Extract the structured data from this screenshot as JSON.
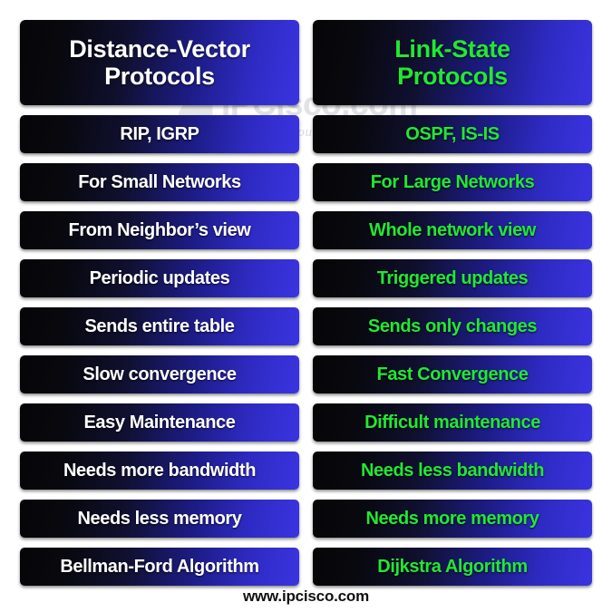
{
  "page": {
    "background_color": "#ffffff",
    "footer_text": "www.ipcisco.com"
  },
  "watermark": {
    "brand_text": "IPCisco.com",
    "tagline": "Best Route To Your IT Career",
    "logo_icon": "sail-leaf-icon",
    "color": "#b9bcc4"
  },
  "colors": {
    "bar_gradient_start": "#060608",
    "bar_gradient_end": "#3a34e0",
    "left_text": "#ffffff",
    "right_text": "#22e832"
  },
  "columns": {
    "left": {
      "header": "Distance-Vector\nProtocols",
      "text_color": "#ffffff",
      "rows": [
        "RIP, IGRP",
        "For Small Networks",
        "From Neighbor’s view",
        "Periodic updates",
        "Sends entire table",
        "Slow convergence",
        "Easy Maintenance",
        "Needs more bandwidth",
        "Needs less memory",
        "Bellman-Ford Algorithm"
      ]
    },
    "right": {
      "header": "Link-State\nProtocols",
      "text_color": "#22e832",
      "rows": [
        "OSPF, IS-IS",
        "For Large Networks",
        "Whole network view",
        "Triggered updates",
        "Sends only changes",
        "Fast Convergence",
        "Difficult maintenance",
        "Needs less bandwidth",
        "Needs more memory",
        "Dijkstra Algorithm"
      ]
    }
  },
  "comparison_pairs": [
    {
      "distance_vector": "RIP, IGRP",
      "link_state": "OSPF, IS-IS"
    },
    {
      "distance_vector": "For Small Networks",
      "link_state": "For Large Networks"
    },
    {
      "distance_vector": "From Neighbor’s view",
      "link_state": "Whole network view"
    },
    {
      "distance_vector": "Periodic updates",
      "link_state": "Triggered updates"
    },
    {
      "distance_vector": "Sends entire table",
      "link_state": "Sends only changes"
    },
    {
      "distance_vector": "Slow convergence",
      "link_state": "Fast Convergence"
    },
    {
      "distance_vector": "Easy Maintenance",
      "link_state": "Difficult maintenance"
    },
    {
      "distance_vector": "Needs more bandwidth",
      "link_state": "Needs less bandwidth"
    },
    {
      "distance_vector": "Needs less memory",
      "link_state": "Needs more memory"
    },
    {
      "distance_vector": "Bellman-Ford Algorithm",
      "link_state": "Dijkstra Algorithm"
    }
  ]
}
